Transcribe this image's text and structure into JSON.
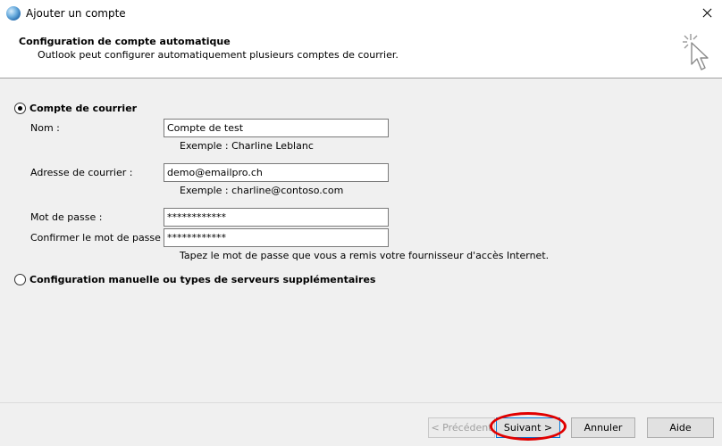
{
  "window": {
    "title": "Ajouter un compte"
  },
  "header": {
    "title": "Configuration de compte automatique",
    "subtitle": "Outlook peut configurer automatiquement plusieurs comptes de courrier."
  },
  "options": {
    "email_account_label": "Compte de courrier",
    "manual_label": "Configuration manuelle ou types de serveurs supplémentaires",
    "selected": "email_account"
  },
  "form": {
    "name": {
      "label": "Nom :",
      "value": "Compte de test",
      "hint": "Exemple : Charline Leblanc"
    },
    "email": {
      "label": "Adresse de courrier :",
      "value": "demo@emailpro.ch",
      "hint": "Exemple : charline@contoso.com"
    },
    "password": {
      "label": "Mot de passe :",
      "value": "************"
    },
    "confirm_password": {
      "label": "Confirmer le mot de passe :",
      "value": "************"
    },
    "password_hint": "Tapez le mot de passe que vous a remis votre fournisseur d'accès Internet."
  },
  "footer": {
    "previous_label": "< Précédent",
    "next_label": "Suivant >",
    "cancel_label": "Annuler",
    "help_label": "Aide"
  }
}
